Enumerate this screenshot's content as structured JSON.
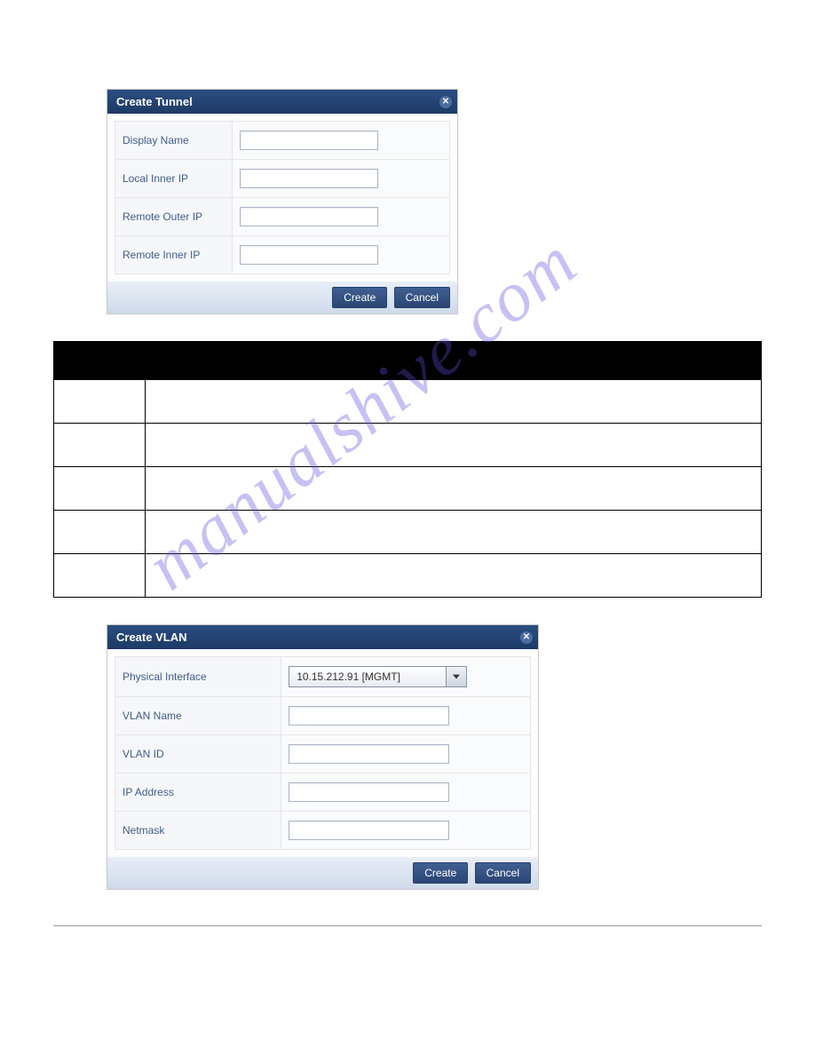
{
  "watermark_text": "manualshive.com",
  "tunnel_dialog": {
    "title": "Create Tunnel",
    "fields": {
      "display_name_label": "Display Name",
      "local_inner_ip_label": "Local Inner IP",
      "remote_outer_ip_label": "Remote Outer IP",
      "remote_inner_ip_label": "Remote Inner IP"
    },
    "buttons": {
      "create": "Create",
      "cancel": "Cancel"
    }
  },
  "info_table": {
    "headers": [
      "",
      ""
    ],
    "rows": [
      [
        "",
        ""
      ],
      [
        "",
        ""
      ],
      [
        "",
        ""
      ],
      [
        "",
        ""
      ],
      [
        "",
        ""
      ]
    ]
  },
  "vlan_dialog": {
    "title": "Create VLAN",
    "fields": {
      "physical_interface_label": "Physical Interface",
      "physical_interface_value": "10.15.212.91 [MGMT]",
      "vlan_name_label": "VLAN Name",
      "vlan_id_label": "VLAN ID",
      "ip_address_label": "IP Address",
      "netmask_label": "Netmask"
    },
    "buttons": {
      "create": "Create",
      "cancel": "Cancel"
    }
  }
}
